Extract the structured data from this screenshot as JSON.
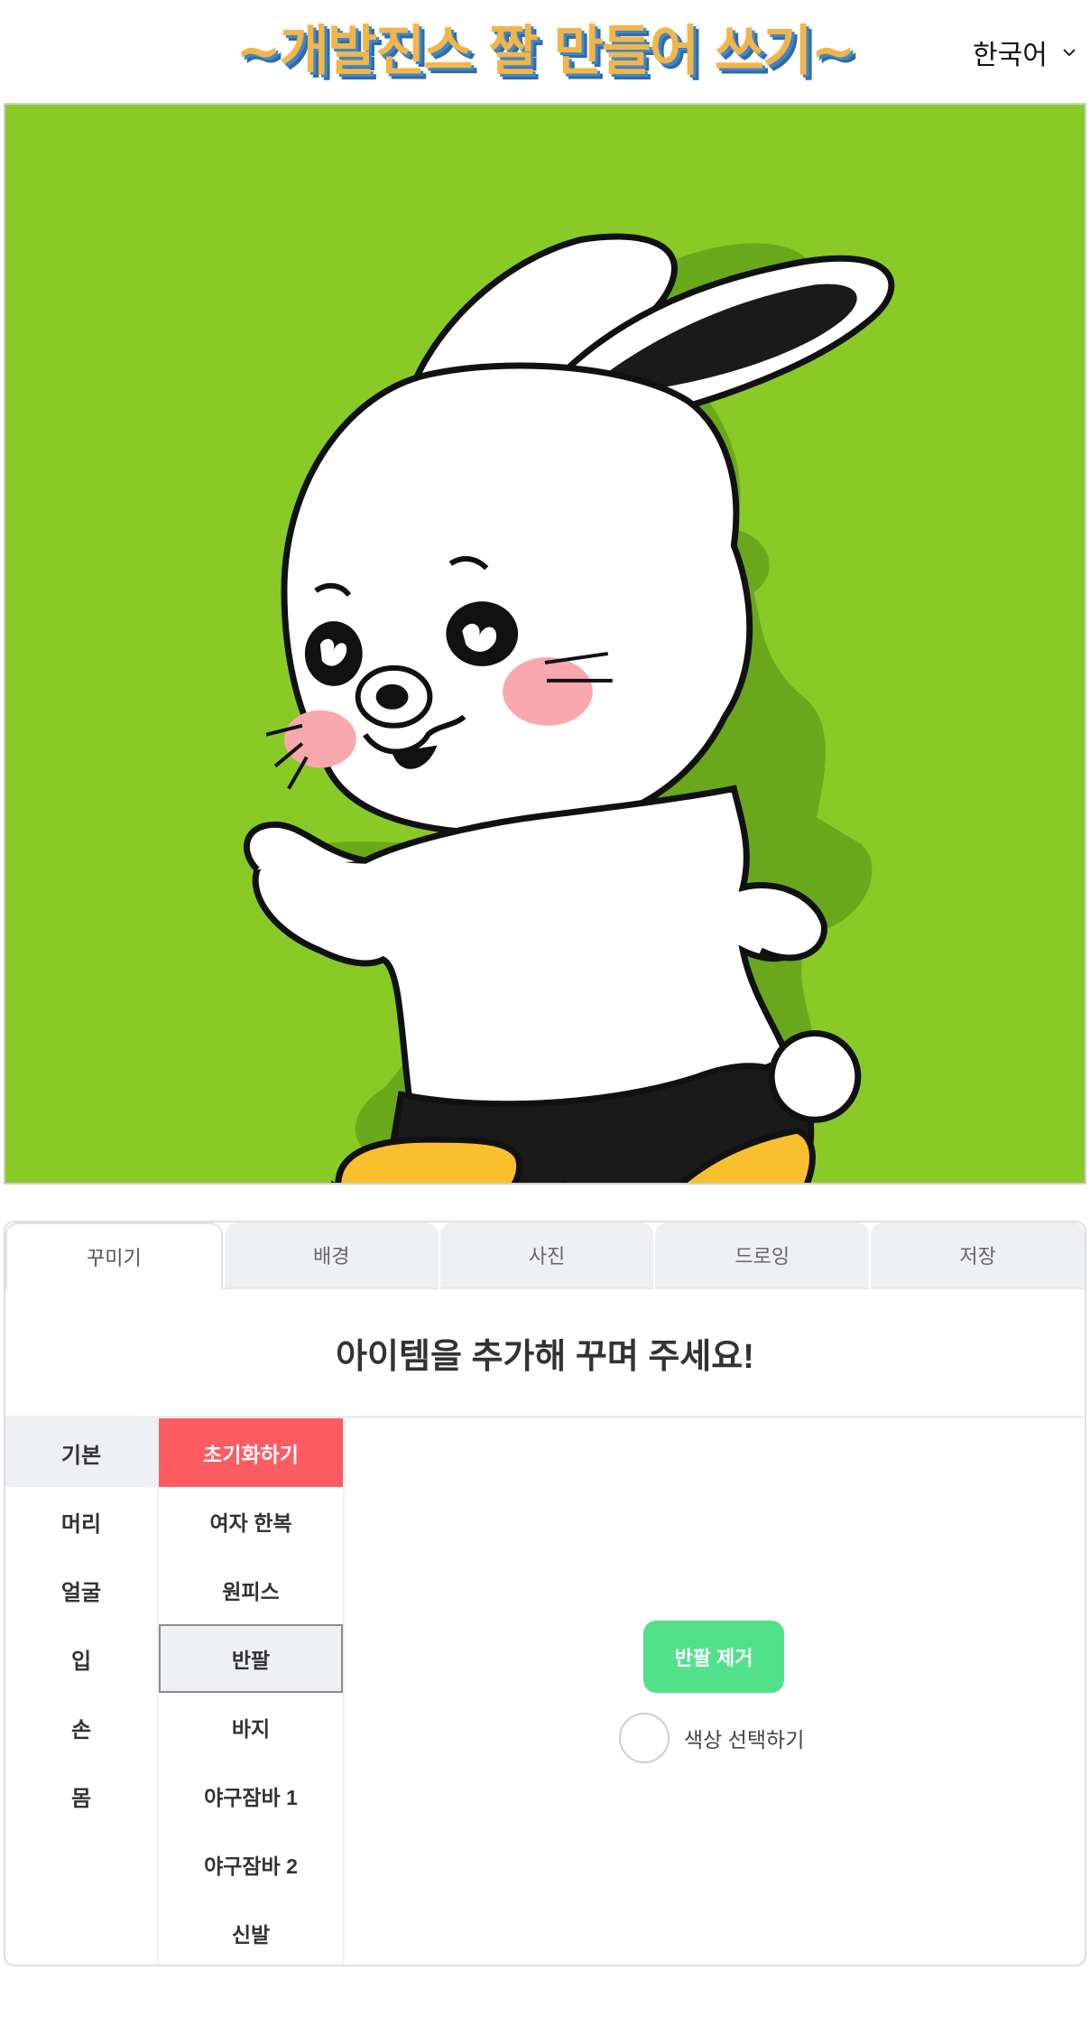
{
  "header": {
    "title": "~개발진스 짤 만들어 쓰기~",
    "language": "한국어",
    "language_icon": "chevron-down-icon"
  },
  "colors": {
    "title": "#f3b54a",
    "title_shadow": "#3f88c8",
    "canvas_bg": "#8aca26",
    "reset_button": "#fd5c63",
    "remove_button": "#52e08b"
  },
  "canvas": {
    "background_color": "#8aca26",
    "character": "rabbit-character"
  },
  "tabs": [
    {
      "label": "꾸미기",
      "active": true
    },
    {
      "label": "배경",
      "active": false
    },
    {
      "label": "사진",
      "active": false
    },
    {
      "label": "드로잉",
      "active": false
    },
    {
      "label": "저장",
      "active": false
    }
  ],
  "panel": {
    "heading": "아이템을 추가해 꾸며 주세요!",
    "categories": [
      "기본",
      "머리",
      "얼굴",
      "입",
      "손",
      "몸"
    ],
    "active_category": "기본",
    "items": [
      "초기화하기",
      "여자 한복",
      "원피스",
      "반팔",
      "바지",
      "야구잠바 1",
      "야구잠바 2",
      "신발"
    ],
    "selected_item": "반팔",
    "remove_button": "반팔 제거",
    "color_label": "색상 선택하기"
  }
}
